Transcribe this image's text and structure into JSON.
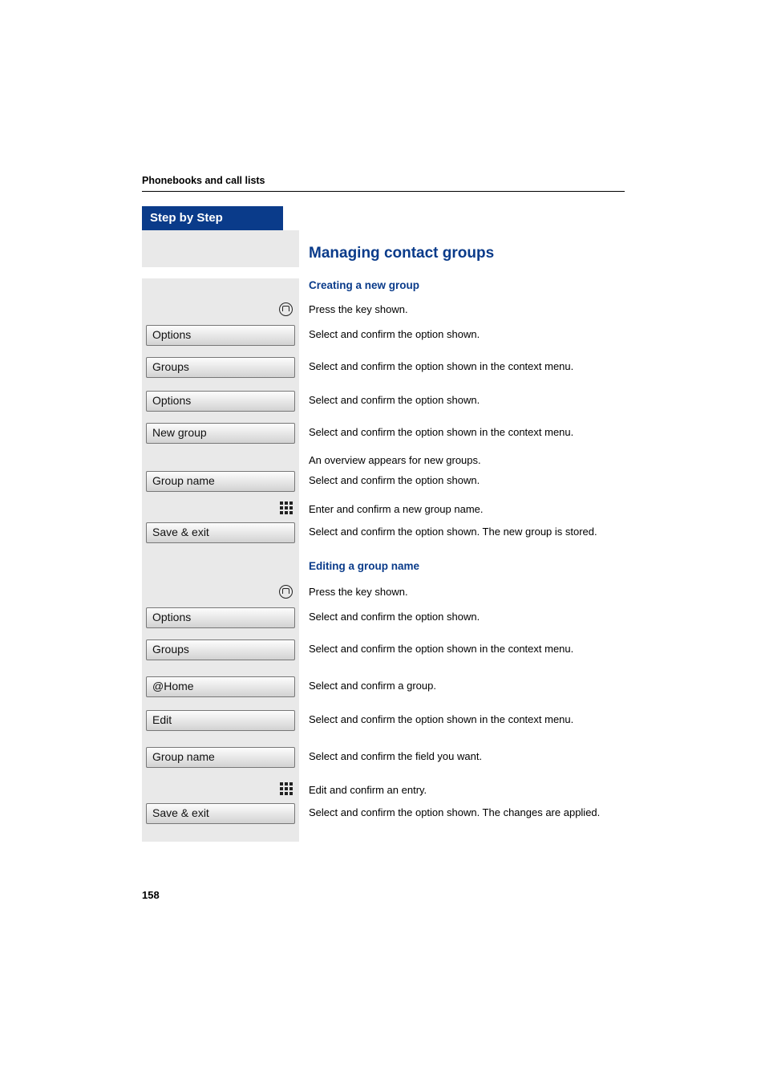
{
  "header": {
    "title": "Phonebooks and call lists"
  },
  "badge": "Step by Step",
  "section_title": "Managing contact groups",
  "sub1": {
    "title": "Creating a new group",
    "steps": [
      {
        "icon": "phonebook",
        "desc": "Press the key shown."
      },
      {
        "menu": "Options",
        "desc": "Select and confirm the option shown."
      },
      {
        "menu": "Groups",
        "desc": "Select and confirm the option shown in the context menu."
      },
      {
        "menu": "Options",
        "desc": "Select and confirm the option shown."
      },
      {
        "menu": "New group",
        "desc": "Select and confirm the option shown in the context menu."
      },
      {
        "desc": "An overview appears for new groups."
      },
      {
        "menu": "Group name",
        "desc": "Select and confirm the option shown."
      },
      {
        "icon": "keypad",
        "desc": "Enter and confirm a new group name."
      },
      {
        "menu": "Save & exit",
        "desc": "Select and confirm the option shown. The new group is stored."
      }
    ]
  },
  "sub2": {
    "title": "Editing a group name",
    "steps": [
      {
        "icon": "phonebook",
        "desc": "Press the key shown."
      },
      {
        "menu": "Options",
        "desc": "Select and confirm the option shown."
      },
      {
        "menu": "Groups",
        "desc": "Select and confirm the option shown in the context menu."
      },
      {
        "menu": "@Home",
        "desc": "Select and confirm a group."
      },
      {
        "menu": "Edit",
        "desc": "Select and confirm the option shown in the context menu."
      },
      {
        "menu": "Group name",
        "desc": "Select and confirm the field you want."
      },
      {
        "icon": "keypad",
        "desc": "Edit and confirm an entry."
      },
      {
        "menu": "Save & exit",
        "desc": "Select and confirm the option shown. The changes are applied."
      }
    ]
  },
  "page_number": "158"
}
